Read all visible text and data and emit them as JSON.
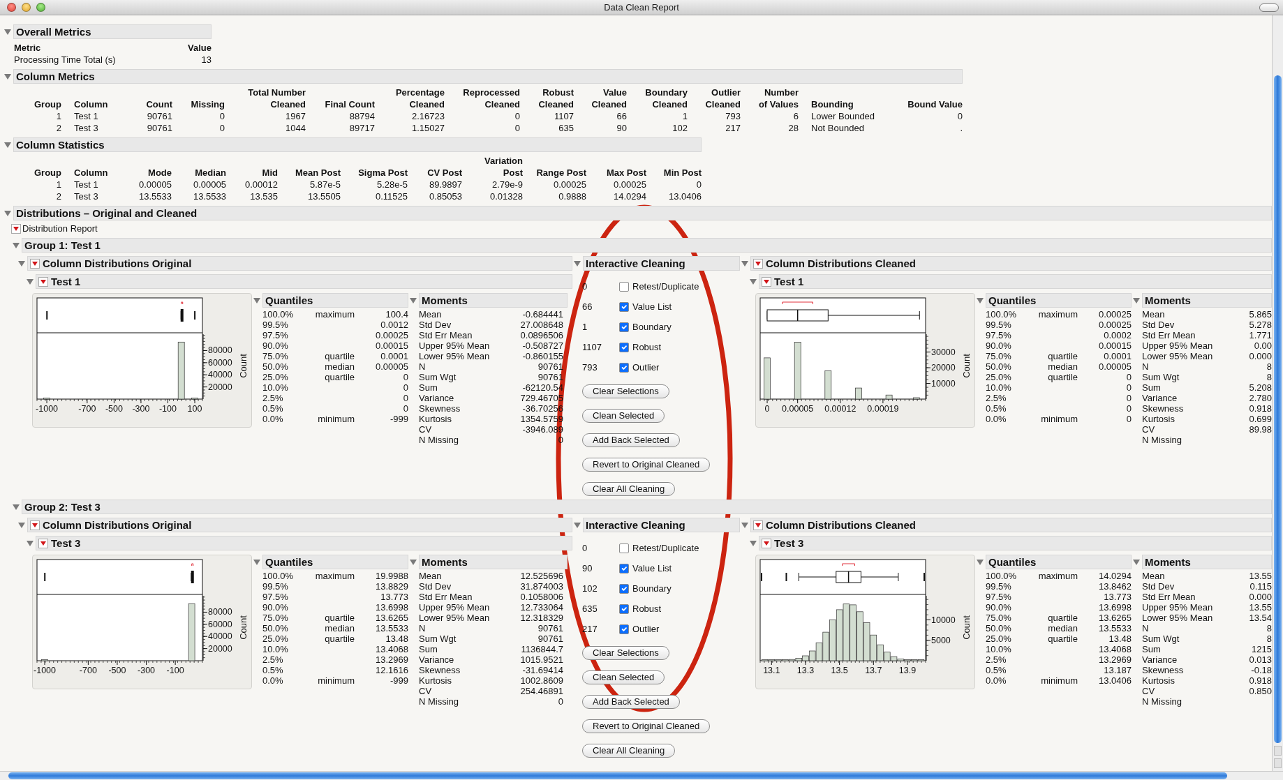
{
  "window": {
    "title": "Data Clean Report"
  },
  "overall_metrics": {
    "title": "Overall Metrics",
    "expanded": true,
    "table": {
      "columns": [
        {
          "label": "Metric"
        },
        {
          "label": "Value"
        }
      ],
      "rows": [
        [
          "Processing Time Total (s)",
          "13"
        ]
      ]
    }
  },
  "column_metrics": {
    "title": "Column Metrics",
    "expanded": true,
    "table": {
      "columns": [
        {
          "label": "Group"
        },
        {
          "label": "Column"
        },
        {
          "label": "Count"
        },
        {
          "label": "Missing"
        },
        {
          "label": "Total Number\nCleaned"
        },
        {
          "label": "Final Count"
        },
        {
          "label": "Percentage\nCleaned"
        },
        {
          "label": "Reprocessed\nCleaned"
        },
        {
          "label": "Robust\nCleaned"
        },
        {
          "label": "Value\nCleaned"
        },
        {
          "label": "Boundary\nCleaned"
        },
        {
          "label": "Outlier\nCleaned"
        },
        {
          "label": "Number\nof Values"
        },
        {
          "label": "Bounding"
        },
        {
          "label": "Bound Value"
        }
      ],
      "rows": [
        [
          "1",
          "Test 1",
          "90761",
          "0",
          "1967",
          "88794",
          "2.16723",
          "0",
          "1107",
          "66",
          "1",
          "793",
          "6",
          "Lower Bounded",
          "0"
        ],
        [
          "2",
          "Test 3",
          "90761",
          "0",
          "1044",
          "89717",
          "1.15027",
          "0",
          "635",
          "90",
          "102",
          "217",
          "28",
          "Not Bounded",
          "."
        ]
      ]
    }
  },
  "column_statistics": {
    "title": "Column Statistics",
    "expanded": true,
    "table": {
      "columns": [
        {
          "label": "Group"
        },
        {
          "label": "Column"
        },
        {
          "label": "Mode"
        },
        {
          "label": "Median"
        },
        {
          "label": "Mid"
        },
        {
          "label": "Mean Post"
        },
        {
          "label": "Sigma Post"
        },
        {
          "label": "CV Post"
        },
        {
          "label": "Variation\nPost"
        },
        {
          "label": "Range Post"
        },
        {
          "label": "Max Post"
        },
        {
          "label": "Min Post"
        }
      ],
      "rows": [
        [
          "1",
          "Test 1",
          "0.00005",
          "0.00005",
          "0.00012",
          "5.87e-5",
          "5.28e-5",
          "89.9897",
          "2.79e-9",
          "0.00025",
          "0.00025",
          "0"
        ],
        [
          "2",
          "Test 3",
          "13.5533",
          "13.5533",
          "13.535",
          "13.5505",
          "0.11525",
          "0.85053",
          "0.01328",
          "0.9888",
          "14.0294",
          "13.0406"
        ]
      ]
    }
  },
  "distributions": {
    "title": "Distributions – Original and Cleaned",
    "expanded": true,
    "report": {
      "title": "Distribution Report",
      "menu": true
    },
    "groups": [
      {
        "title": "Group 1: Test 1",
        "expanded": true,
        "original": {
          "title": "Column Distributions Original",
          "expanded": true,
          "menu": true,
          "column": {
            "title": "Test 1",
            "expanded": true,
            "menu": true,
            "chart_data": {
              "type": "bar",
              "ylabel": "Count",
              "x": [
                -1000,
                0,
                100
              ],
              "values": [
                1000,
                94000,
                1000
              ],
              "xlim": [
                -1073,
                157
              ],
              "ylim": [
                0,
                107000
              ],
              "xticks": [
                -1000,
                -700,
                -500,
                -300,
                -100,
                100
              ],
              "yticks": [
                20000,
                40000,
                60000,
                80000
              ]
            },
            "quantiles": {
              "title": "Quantiles",
              "expanded": true,
              "rows": [
                {
                  "pct": "100.0%",
                  "label": "maximum",
                  "value": "100.4"
                },
                {
                  "pct": "99.5%",
                  "value": "0.0012"
                },
                {
                  "pct": "97.5%",
                  "value": "0.00025"
                },
                {
                  "pct": "90.0%",
                  "value": "0.00015"
                },
                {
                  "pct": "75.0%",
                  "label": "quartile",
                  "value": "0.0001"
                },
                {
                  "pct": "50.0%",
                  "label": "median",
                  "value": "0.00005"
                },
                {
                  "pct": "25.0%",
                  "label": "quartile",
                  "value": "0"
                },
                {
                  "pct": "10.0%",
                  "value": "0"
                },
                {
                  "pct": "2.5%",
                  "value": "0"
                },
                {
                  "pct": "0.5%",
                  "value": "0"
                },
                {
                  "pct": "0.0%",
                  "label": "minimum",
                  "value": "-999"
                }
              ]
            },
            "moments": {
              "title": "Moments",
              "expanded": true,
              "rows": [
                {
                  "label": "Mean",
                  "value": "-0.684441"
                },
                {
                  "label": "Std Dev",
                  "value": "27.008648"
                },
                {
                  "label": "Std Err Mean",
                  "value": "0.0896506"
                },
                {
                  "label": "Upper 95% Mean",
                  "value": "-0.508727"
                },
                {
                  "label": "Lower 95% Mean",
                  "value": "-0.860155"
                },
                {
                  "label": "N",
                  "value": "90761"
                },
                {
                  "label": "Sum Wgt",
                  "value": "90761"
                },
                {
                  "label": "Sum",
                  "value": "-62120.54"
                },
                {
                  "label": "Variance",
                  "value": "729.46705"
                },
                {
                  "label": "Skewness",
                  "value": "-36.70256"
                },
                {
                  "label": "Kurtosis",
                  "value": "1354.5759"
                },
                {
                  "label": "CV",
                  "value": "-3946.089"
                },
                {
                  "label": "N Missing",
                  "value": "0"
                }
              ]
            }
          }
        },
        "interactive": {
          "title": "Interactive Cleaning",
          "expanded": true,
          "options": [
            {
              "count": "0",
              "label": "Retest/Duplicate",
              "checked": false
            },
            {
              "count": "66",
              "label": "Value List",
              "checked": true
            },
            {
              "count": "1",
              "label": "Boundary",
              "checked": true
            },
            {
              "count": "1107",
              "label": "Robust",
              "checked": true
            },
            {
              "count": "793",
              "label": "Outlier",
              "checked": true
            }
          ],
          "buttons": [
            "Clear Selections",
            "Clean Selected",
            "Add Back Selected",
            "Revert to Original Cleaned",
            "Clear All Cleaning"
          ]
        },
        "cleaned": {
          "title": "Column Distributions Cleaned",
          "expanded": true,
          "menu": true,
          "column": {
            "title": "Test 1",
            "expanded": true,
            "menu": true,
            "chart_data": {
              "type": "bar",
              "ylabel": "Count",
              "x": [
                0,
                5e-05,
                0.0001,
                0.00015,
                0.0002,
                0.000245
              ],
              "values": [
                26300,
                36300,
                18000,
                7100,
                2600,
                900
              ],
              "xlim": [
                -1.15e-05,
                0.00026
              ],
              "ylim": [
                0,
                41400
              ],
              "xticks": [
                0,
                {
                  "value": 5e-05,
                  "label": "0.00005"
                },
                0.00012,
                0.00019
              ],
              "yticks": [
                10000,
                20000,
                30000
              ]
            },
            "quantiles": {
              "title": "Quantiles",
              "expanded": true,
              "rows": [
                {
                  "pct": "100.0%",
                  "label": "maximum",
                  "value": "0.00025"
                },
                {
                  "pct": "99.5%",
                  "value": "0.00025"
                },
                {
                  "pct": "97.5%",
                  "value": "0.0002"
                },
                {
                  "pct": "90.0%",
                  "value": "0.00015"
                },
                {
                  "pct": "75.0%",
                  "label": "quartile",
                  "value": "0.0001"
                },
                {
                  "pct": "50.0%",
                  "label": "median",
                  "value": "0.00005"
                },
                {
                  "pct": "25.0%",
                  "label": "quartile",
                  "value": "0"
                },
                {
                  "pct": "10.0%",
                  "value": "0"
                },
                {
                  "pct": "2.5%",
                  "value": "0"
                },
                {
                  "pct": "0.5%",
                  "value": "0"
                },
                {
                  "pct": "0.0%",
                  "label": "minimum",
                  "value": "0"
                }
              ]
            },
            "moments": {
              "title": "Moments",
              "expanded": true,
              "rows": [
                {
                  "label": "Mean",
                  "value": "5.865"
                },
                {
                  "label": "Std Dev",
                  "value": "5.278"
                },
                {
                  "label": "Std Err Mean",
                  "value": "1.771"
                },
                {
                  "label": "Upper 95% Mean",
                  "value": "0.00"
                },
                {
                  "label": "Lower 95% Mean",
                  "value": "0.000"
                },
                {
                  "label": "N",
                  "value": "8"
                },
                {
                  "label": "Sum Wgt",
                  "value": "8"
                },
                {
                  "label": "Sum",
                  "value": "5.208"
                },
                {
                  "label": "Variance",
                  "value": "2.780"
                },
                {
                  "label": "Skewness",
                  "value": "0.918"
                },
                {
                  "label": "Kurtosis",
                  "value": "0.699"
                },
                {
                  "label": "CV",
                  "value": "89.98"
                },
                {
                  "label": "N Missing"
                }
              ]
            }
          }
        }
      },
      {
        "title": "Group 2: Test 3",
        "expanded": true,
        "original": {
          "title": "Column Distributions Original",
          "expanded": true,
          "menu": true,
          "column": {
            "title": "Test 3",
            "expanded": true,
            "menu": true,
            "chart_data": {
              "type": "bar",
              "ylabel": "Count",
              "x": [
                -1000,
                13
              ],
              "values": [
                1000,
                94000
              ],
              "xlim": [
                -1053,
                87
              ],
              "ylim": [
                0,
                107000
              ],
              "xticks": [
                -1000,
                -700,
                -500,
                -300,
                -100
              ],
              "yticks": [
                20000,
                40000,
                60000,
                80000
              ]
            },
            "quantiles": {
              "title": "Quantiles",
              "expanded": true,
              "rows": [
                {
                  "pct": "100.0%",
                  "label": "maximum",
                  "value": "19.9988"
                },
                {
                  "pct": "99.5%",
                  "value": "13.8829"
                },
                {
                  "pct": "97.5%",
                  "value": "13.773"
                },
                {
                  "pct": "90.0%",
                  "value": "13.6998"
                },
                {
                  "pct": "75.0%",
                  "label": "quartile",
                  "value": "13.6265"
                },
                {
                  "pct": "50.0%",
                  "label": "median",
                  "value": "13.5533"
                },
                {
                  "pct": "25.0%",
                  "label": "quartile",
                  "value": "13.48"
                },
                {
                  "pct": "10.0%",
                  "value": "13.4068"
                },
                {
                  "pct": "2.5%",
                  "value": "13.2969"
                },
                {
                  "pct": "0.5%",
                  "value": "12.1616"
                },
                {
                  "pct": "0.0%",
                  "label": "minimum",
                  "value": "-999"
                }
              ]
            },
            "moments": {
              "title": "Moments",
              "expanded": true,
              "rows": [
                {
                  "label": "Mean",
                  "value": "12.525696"
                },
                {
                  "label": "Std Dev",
                  "value": "31.874003"
                },
                {
                  "label": "Std Err Mean",
                  "value": "0.1058006"
                },
                {
                  "label": "Upper 95% Mean",
                  "value": "12.733064"
                },
                {
                  "label": "Lower 95% Mean",
                  "value": "12.318329"
                },
                {
                  "label": "N",
                  "value": "90761"
                },
                {
                  "label": "Sum Wgt",
                  "value": "90761"
                },
                {
                  "label": "Sum",
                  "value": "1136844.7"
                },
                {
                  "label": "Variance",
                  "value": "1015.9521"
                },
                {
                  "label": "Skewness",
                  "value": "-31.69414"
                },
                {
                  "label": "Kurtosis",
                  "value": "1002.8609"
                },
                {
                  "label": "CV",
                  "value": "254.46891"
                },
                {
                  "label": "N Missing",
                  "value": "0"
                }
              ]
            }
          }
        },
        "interactive": {
          "title": "Interactive Cleaning",
          "expanded": true,
          "options": [
            {
              "count": "0",
              "label": "Retest/Duplicate",
              "checked": false
            },
            {
              "count": "90",
              "label": "Value List",
              "checked": true
            },
            {
              "count": "102",
              "label": "Boundary",
              "checked": true
            },
            {
              "count": "635",
              "label": "Robust",
              "checked": true
            },
            {
              "count": "217",
              "label": "Outlier",
              "checked": true
            }
          ],
          "buttons": [
            "Clear Selections",
            "Clean Selected",
            "Add Back Selected",
            "Revert to Original Cleaned",
            "Clear All Cleaning"
          ]
        },
        "cleaned": {
          "title": "Column Distributions Cleaned",
          "expanded": true,
          "menu": true,
          "column": {
            "title": "Test 3",
            "expanded": true,
            "menu": true,
            "chart_data": {
              "type": "bar",
              "ylabel": "Count",
              "x": [
                13.06,
                13.1,
                13.14,
                13.18,
                13.22,
                13.26,
                13.3,
                13.34,
                13.38,
                13.42,
                13.46,
                13.5,
                13.54,
                13.58,
                13.62,
                13.66,
                13.7,
                13.74,
                13.78,
                13.82,
                13.86,
                13.9,
                13.94,
                13.98
              ],
              "values": [
                200,
                200,
                200,
                200,
                300,
                600,
                1200,
                2400,
                4400,
                7000,
                10000,
                12500,
                13900,
                13700,
                12000,
                9300,
                6300,
                3900,
                2100,
                1000,
                400,
                200,
                200,
                200
              ],
              "xlim": [
                13.033,
                14.007
              ],
              "ylim": [
                0,
                15900
              ],
              "xticks": [
                13.1,
                13.3,
                13.5,
                13.7,
                13.9
              ],
              "yticks": [
                5000,
                10000
              ]
            },
            "quantiles": {
              "title": "Quantiles",
              "expanded": true,
              "rows": [
                {
                  "pct": "100.0%",
                  "label": "maximum",
                  "value": "14.0294"
                },
                {
                  "pct": "99.5%",
                  "value": "13.8462"
                },
                {
                  "pct": "97.5%",
                  "value": "13.773"
                },
                {
                  "pct": "90.0%",
                  "value": "13.6998"
                },
                {
                  "pct": "75.0%",
                  "label": "quartile",
                  "value": "13.6265"
                },
                {
                  "pct": "50.0%",
                  "label": "median",
                  "value": "13.5533"
                },
                {
                  "pct": "25.0%",
                  "label": "quartile",
                  "value": "13.48"
                },
                {
                  "pct": "10.0%",
                  "value": "13.4068"
                },
                {
                  "pct": "2.5%",
                  "value": "13.2969"
                },
                {
                  "pct": "0.5%",
                  "value": "13.187"
                },
                {
                  "pct": "0.0%",
                  "label": "minimum",
                  "value": "13.0406"
                }
              ]
            },
            "moments": {
              "title": "Moments",
              "expanded": true,
              "rows": [
                {
                  "label": "Mean",
                  "value": "13.55"
                },
                {
                  "label": "Std Dev",
                  "value": "0.115"
                },
                {
                  "label": "Std Err Mean",
                  "value": "0.000"
                },
                {
                  "label": "Upper 95% Mean",
                  "value": "13.55"
                },
                {
                  "label": "Lower 95% Mean",
                  "value": "13.54"
                },
                {
                  "label": "N",
                  "value": "8"
                },
                {
                  "label": "Sum Wgt",
                  "value": "8"
                },
                {
                  "label": "Sum",
                  "value": "1215"
                },
                {
                  "label": "Variance",
                  "value": "0.013"
                },
                {
                  "label": "Skewness",
                  "value": "-0.18"
                },
                {
                  "label": "Kurtosis",
                  "value": "0.918"
                },
                {
                  "label": "CV",
                  "value": "0.850"
                },
                {
                  "label": "N Missing"
                }
              ]
            }
          }
        }
      }
    ]
  }
}
